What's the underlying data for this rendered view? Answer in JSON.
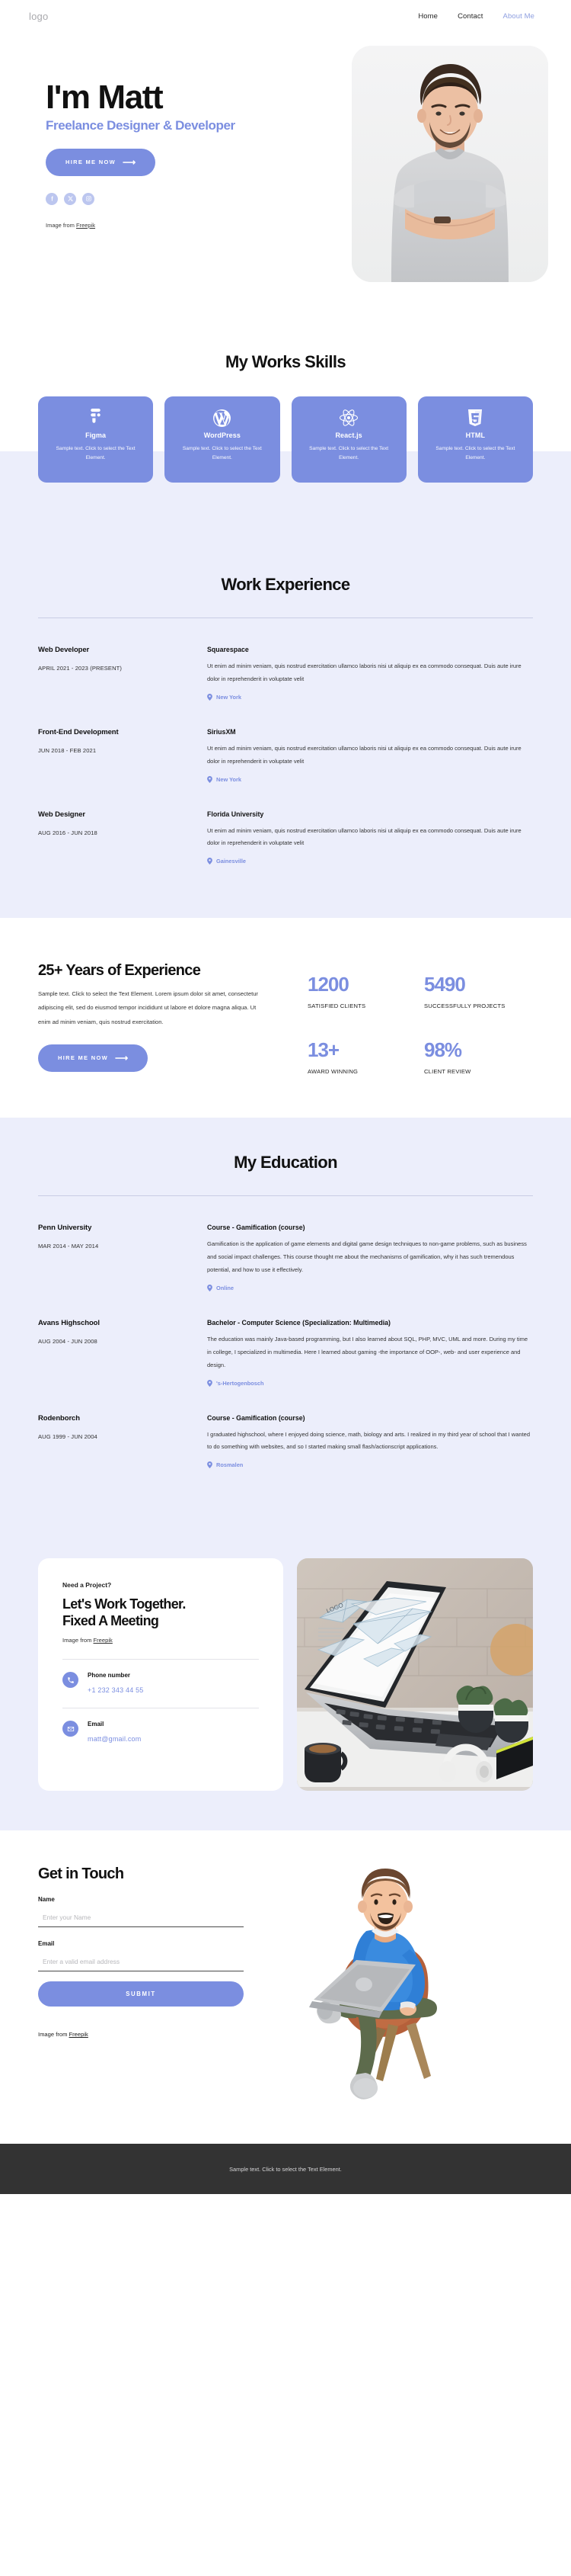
{
  "header": {
    "logo": "logo",
    "nav": [
      {
        "label": "Home",
        "active": false
      },
      {
        "label": "Contact",
        "active": false
      },
      {
        "label": "About Me",
        "active": true
      }
    ]
  },
  "hero": {
    "title": "I'm Matt",
    "subtitle": "Freelance Designer & Developer",
    "cta_label": "HIRE ME NOW",
    "cta_arrow": "⟶",
    "socials": [
      "facebook-icon",
      "x-twitter-icon",
      "instagram-icon"
    ],
    "credit_prefix": "Image from ",
    "credit_link": "Freepik",
    "photo_alt": "portrait-photo-man-crossed-arms"
  },
  "skills": {
    "title": "My Works Skills",
    "cards": [
      {
        "icon": "figma-icon",
        "name": "Figma",
        "desc": "Sample text. Click to select the Text Element."
      },
      {
        "icon": "wordpress-icon",
        "name": "WordPress",
        "desc": "Sample text. Click to select the Text Element."
      },
      {
        "icon": "react-icon",
        "name": "React.js",
        "desc": "Sample text. Click to select the Text Element."
      },
      {
        "icon": "html5-icon",
        "name": "HTML",
        "desc": "Sample text. Click to select the Text Element."
      }
    ]
  },
  "work": {
    "title": "Work Experience",
    "items": [
      {
        "role": "Web Developer",
        "date": "APRIL 2021 - 2023 (PRESENT)",
        "org": "Squarespace",
        "desc": "Ut enim ad minim veniam, quis nostrud exercitation ullamco laboris nisi ut aliquip ex ea commodo consequat. Duis aute irure dolor in reprehenderit in voluptate velit",
        "location": "New York"
      },
      {
        "role": "Front-End Development",
        "date": "JUN 2018 - FEB 2021",
        "org": "SiriusXM",
        "desc": "Ut enim ad minim veniam, quis nostrud exercitation ullamco laboris nisi ut aliquip ex ea commodo consequat. Duis aute irure dolor in reprehenderit in voluptate velit",
        "location": "New York"
      },
      {
        "role": "Web Designer",
        "date": "AUG 2016 - JUN 2018",
        "org": "Florida University",
        "desc": "Ut enim ad minim veniam, quis nostrud exercitation ullamco laboris nisi ut aliquip ex ea commodo consequat. Duis aute irure dolor in reprehenderit in voluptate velit",
        "location": "Gainesville"
      }
    ]
  },
  "experience": {
    "title": "25+ Years of Experience",
    "paragraph": "Sample text. Click to select the Text Element. Lorem ipsum dolor sit amet, consectetur adipiscing elit, sed do eiusmod tempor incididunt ut labore et dolore magna aliqua. Ut enim ad minim veniam, quis nostrud exercitation.",
    "cta_label": "HIRE ME NOW",
    "cta_arrow": "⟶",
    "stats": [
      {
        "value": "1200",
        "label": "SATISFIED CLIENTS"
      },
      {
        "value": "5490",
        "label": "SUCCESSFULLY PROJECTS"
      },
      {
        "value": "13+",
        "label": "AWARD WINNING"
      },
      {
        "value": "98%",
        "label": "CLIENT REVIEW"
      }
    ]
  },
  "education": {
    "title": "My Education",
    "items": [
      {
        "school": "Penn University",
        "date": "MAR 2014 - MAY 2014",
        "course": "Course - Gamification (course)",
        "desc": "Gamification is the application of game elements and digital game design techniques to non-game problems, such as business and social impact challenges. This course thought me about the mechanisms of gamification, why it has such tremendous potential, and how to use it effectively.",
        "location": "Online"
      },
      {
        "school": "Avans Highschool",
        "date": "AUG 2004 - JUN 2008",
        "course": "Bachelor - Computer Science (Specialization: Multimedia)",
        "desc": "The education was mainly Java-based programming, but I also learned about SQL, PHP, MVC, UML and more. During my time in college, I specialized in multimedia. Here I learned about gaming -the importance of OOP-, web- and user experience and design.",
        "location": "'s-Hertogenbosch"
      },
      {
        "school": "Rodenborch",
        "date": "AUG 1999 - JUN 2004",
        "course": "Course - Gamification (course)",
        "desc": "I graduated highschool, where I enjoyed doing science, math, biology and arts. I realized in my third year of school that I wanted to do something with websites, and so I started making small flash/actionscript applications.",
        "location": "Rosmalen"
      }
    ]
  },
  "meeting": {
    "kicker": "Need a Project?",
    "title_line1": "Let's Work Together.",
    "title_line2": "Fixed A Meeting",
    "credit_prefix": "Image from ",
    "credit_link": "Freepik",
    "phone_label": "Phone number",
    "phone_value": "+1 232 343 44 55",
    "phone_icon": "phone-icon",
    "email_label": "Email",
    "email_value": "matt@gmail.com",
    "email_icon": "envelope-icon",
    "photo_alt": "laptop-wireframe-desk-plants-coffee"
  },
  "touch": {
    "title": "Get in Touch",
    "name_label": "Name",
    "name_placeholder": "Enter your Name",
    "name_value": "",
    "email_label": "Email",
    "email_placeholder": "Enter a valid email address",
    "email_value": "",
    "submit_label": "SUBMIT",
    "credit_prefix": "Image from ",
    "credit_link": "Freepik",
    "art_alt": "3d-character-sitting-chair-with-laptop"
  },
  "footer": {
    "text": "Sample text. Click to select the Text Element."
  },
  "colors": {
    "accent": "#7b8ee0",
    "accent_light": "#bcc6ef",
    "lavender_bg": "#eceefb",
    "footer_bg": "#333333",
    "text": "#111111"
  }
}
